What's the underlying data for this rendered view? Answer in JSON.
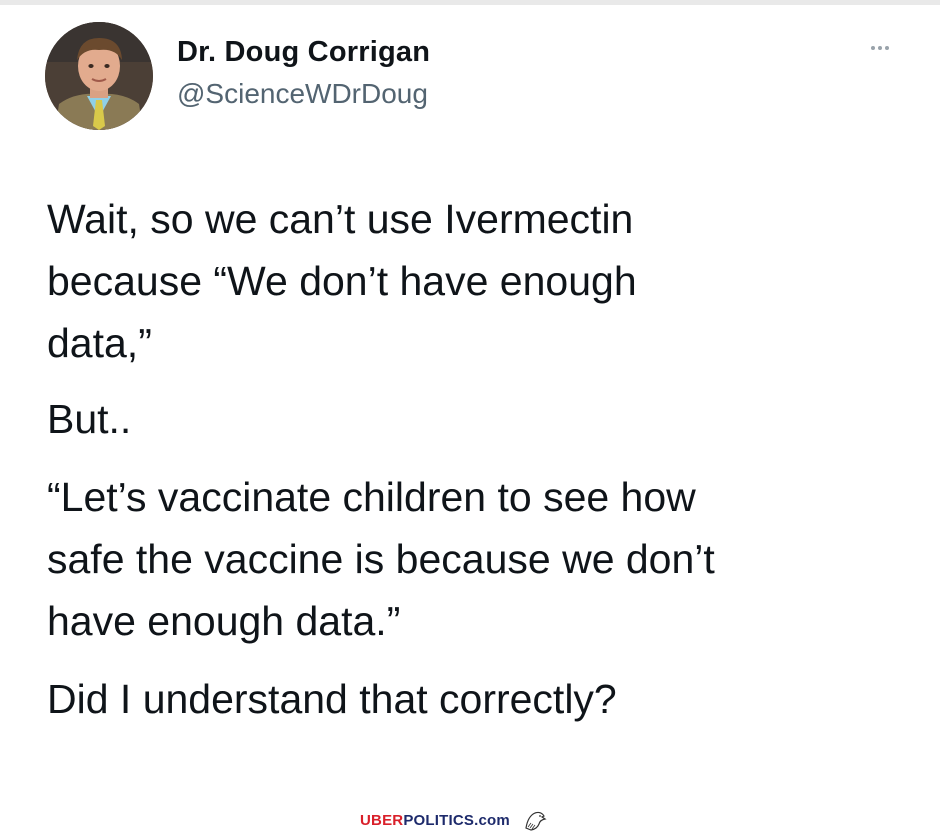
{
  "tweet": {
    "display_name": "Dr. Doug Corrigan",
    "handle": "@ScienceWDrDoug",
    "body": [
      "Wait, so we can’t use Ivermectin\nbecause “We don’t have enough\ndata,”",
      "But..",
      "“Let’s vaccinate children to see how\nsafe the vaccine is because we don’t\nhave enough data.”",
      "Did I understand that correctly?"
    ]
  },
  "icons": {
    "avatar": "profile-photo",
    "more": "more-horizontal-icon",
    "watermark_logo": "eagle-icon"
  },
  "watermark": {
    "part1": "UBER",
    "part2": "POLITICS",
    "part3": ".com"
  },
  "colors": {
    "text": "#0f1419",
    "secondary_text": "#536471",
    "watermark_red": "#d9202a",
    "watermark_navy": "#1d2a6b"
  }
}
